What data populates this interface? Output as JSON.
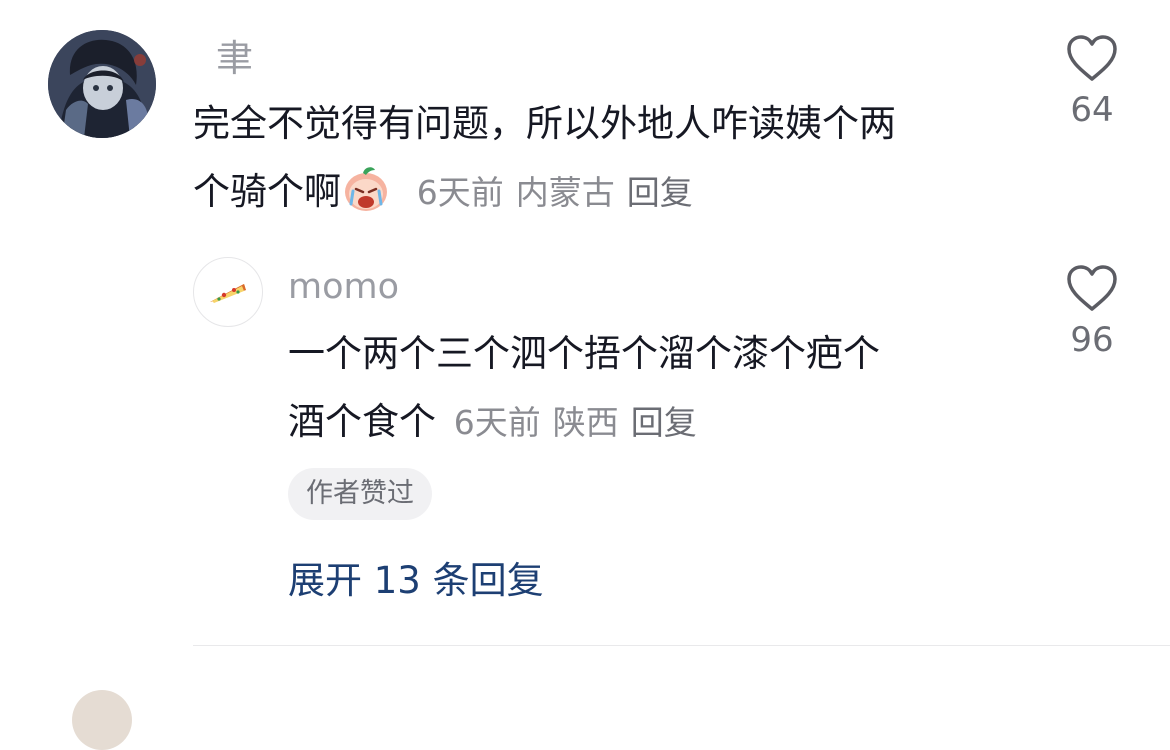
{
  "comment": {
    "username": "聿",
    "text_line1": "完全不觉得有问题，所以外地人咋读姨个两",
    "text_line2": "个骑个啊",
    "emoji": "peach-crying-sticker",
    "time": "6天前",
    "location": "内蒙古",
    "reply_label": "回复",
    "likes": "64"
  },
  "reply": {
    "username": "momo",
    "avatar_icon": "pizza-icon",
    "text_line1": "一个两个三个泗个捂个溜个漆个疤个",
    "text_line2": "酒个食个",
    "time": "6天前",
    "location": "陕西",
    "reply_label": "回复",
    "likes": "96",
    "author_liked": "作者赞过"
  },
  "expand_label": "展开 13 条回复",
  "colors": {
    "text": "#161823",
    "meta": "#8a8b91",
    "link": "#1d3f73",
    "badge_bg": "#f1f1f3"
  }
}
